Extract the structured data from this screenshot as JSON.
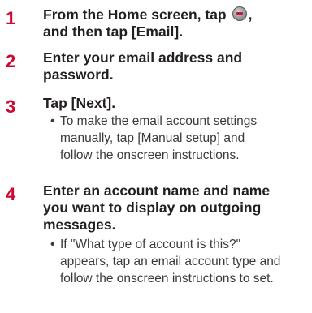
{
  "steps": [
    {
      "number": "1",
      "heading_part1": "From the Home screen, tap",
      "heading_part2": ",",
      "heading_part3": "and then tap [Email].",
      "icon": "apps-icon"
    },
    {
      "number": "2",
      "heading_line1": "Enter your email address and",
      "heading_line2": "password."
    },
    {
      "number": "3",
      "heading": "Tap [Next].",
      "bullet": "•",
      "bullet_line1": "To make the email account settings",
      "bullet_line2": "manually, tap [Manual setup] and",
      "bullet_line3": "follow the onscreen instructions."
    },
    {
      "number": "4",
      "heading_line1": "Enter an account name and name",
      "heading_line2": "you want to display on outgoing",
      "heading_line3": "messages.",
      "bullet": "•",
      "bullet_line1": "If \"What type of account is this?\"",
      "bullet_line2": "appears, tap an email account type and",
      "bullet_line3": "follow the onscreen instructions to set."
    }
  ],
  "colors": {
    "step_number": "#cc0a30",
    "heading_text": "#231f20",
    "body_text": "#3a3a3a"
  }
}
